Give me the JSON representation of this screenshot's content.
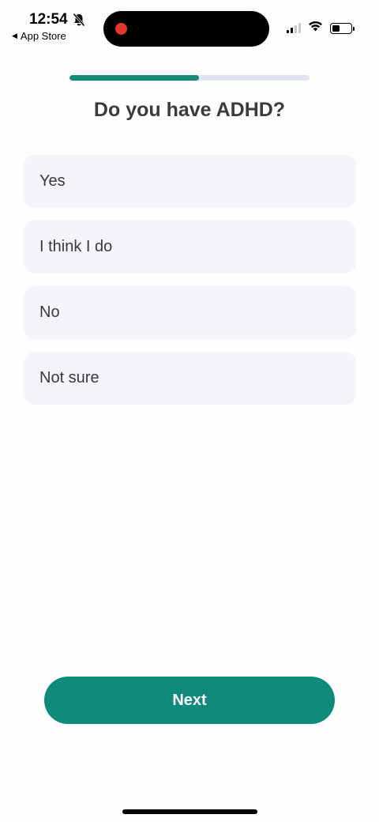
{
  "status_bar": {
    "time": "12:54",
    "back_label": "App Store",
    "back_icon": "back-triangle-icon",
    "silent_icon": "bell-slash-icon",
    "recording_indicator_color": "#e0382f",
    "signal_bars_active": 2,
    "battery_level": 0.35
  },
  "progress": {
    "value": 0.54,
    "color": "#148a77"
  },
  "question": {
    "title": "Do you have ADHD?"
  },
  "options": [
    {
      "label": "Yes"
    },
    {
      "label": "I think I do"
    },
    {
      "label": "No"
    },
    {
      "label": "Not sure"
    }
  ],
  "footer": {
    "next_label": "Next",
    "accent": "#0f8a7b"
  }
}
